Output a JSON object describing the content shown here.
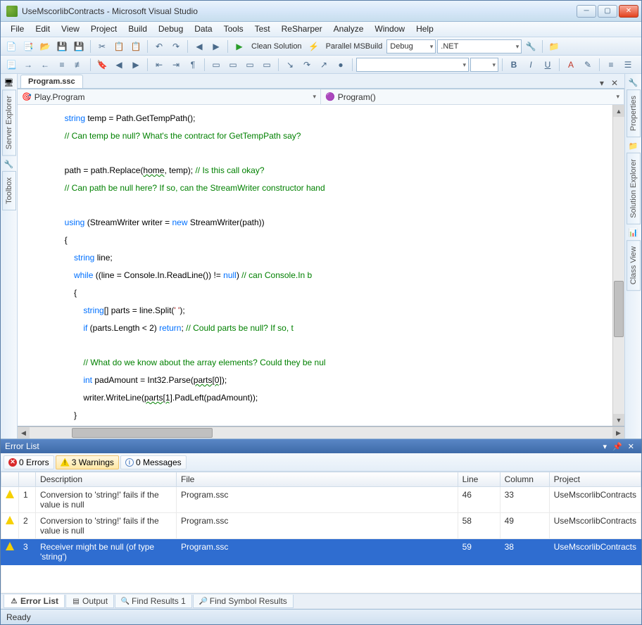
{
  "title": "UseMscorlibContracts - Microsoft Visual Studio",
  "menu": [
    "File",
    "Edit",
    "View",
    "Project",
    "Build",
    "Debug",
    "Data",
    "Tools",
    "Test",
    "ReSharper",
    "Analyze",
    "Window",
    "Help"
  ],
  "toolbar1": {
    "clean": "Clean Solution",
    "parallel": "Parallel MSBuild",
    "config": "Debug",
    "platform": ".NET"
  },
  "sideLeft": [
    "Server Explorer",
    "Toolbox"
  ],
  "sideRight": [
    "Properties",
    "Solution Explorer",
    "Class View"
  ],
  "docTab": "Program.ssc",
  "nav": {
    "left": "Play.Program",
    "right": "Program()"
  },
  "code": {
    "indent1": "        ",
    "indent2": "            ",
    "indent3": "                ",
    "l1a": "string",
    "l1b": " temp = Path.GetTempPath();",
    "l2": "// Can temp be null? What's the contract for GetTempPath say?",
    "l3a": "path = path.Replace(",
    "l3b": "home",
    "l3c": ", temp); ",
    "l3d": "// Is this call okay?",
    "l4": "// Can path be null here? If so, can the StreamWriter constructor hand",
    "l5a": "using",
    "l5b": " (StreamWriter writer = ",
    "l5c": "new",
    "l5d": " StreamWriter(path))",
    "l6": "{",
    "l7a": "string",
    "l7b": " line;",
    "l8a": "while",
    "l8b": " ((line = Console.In.ReadLine()) != ",
    "l8c": "null",
    "l8d": ") ",
    "l8e": "// can Console.In b",
    "l9": "{",
    "l10a": "string",
    "l10b": "[] parts = line.Split(",
    "l10c": "' '",
    "l10d": ");",
    "l11a": "if",
    "l11b": " (parts.Length < 2) ",
    "l11c": "return",
    "l11d": "; ",
    "l11e": "// Could parts be null? If so, t",
    "l12": "// What do we know about the array elements? Could they be nul",
    "l13a": "int",
    "l13b": " padAmount = Int32.Parse(",
    "l13c": "parts[0]",
    "l13d": ");",
    "l14a": "writer.WriteLine(",
    "l14b": "parts[1]",
    "l14c": ".PadLeft(padAmount));",
    "l15": "}"
  },
  "errorPanel": {
    "title": "Error List",
    "filters": {
      "errors": "0 Errors",
      "warnings": "3 Warnings",
      "messages": "0 Messages"
    },
    "cols": [
      "",
      "",
      "Description",
      "File",
      "Line",
      "Column",
      "Project"
    ],
    "rows": [
      {
        "n": "1",
        "desc": "Conversion to 'string!' fails if the value is null",
        "file": "Program.ssc",
        "line": "46",
        "col": "33",
        "proj": "UseMscorlibContracts"
      },
      {
        "n": "2",
        "desc": "Conversion to 'string!' fails if the value is null",
        "file": "Program.ssc",
        "line": "58",
        "col": "49",
        "proj": "UseMscorlibContracts"
      },
      {
        "n": "3",
        "desc": "Receiver might be null (of type 'string')",
        "file": "Program.ssc",
        "line": "59",
        "col": "38",
        "proj": "UseMscorlibContracts"
      }
    ],
    "tabs": [
      "Error List",
      "Output",
      "Find Results 1",
      "Find Symbol Results"
    ]
  },
  "status": "Ready"
}
